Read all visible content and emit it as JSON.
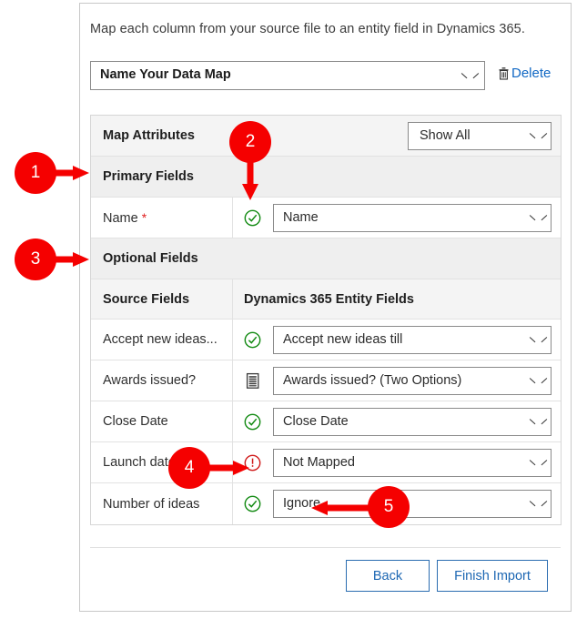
{
  "panel": {
    "intro": "Map each column from your source file to an entity field in Dynamics 365.",
    "data_map": {
      "selected": "Name Your Data Map",
      "delete_label": "Delete",
      "trash_icon": "trash-icon",
      "chevron_icon": "chevron-down-icon"
    }
  },
  "table": {
    "map_attributes": {
      "label": "Map Attributes",
      "filter_selected": "Show All"
    },
    "sections": [
      {
        "label": "Primary Fields"
      },
      {
        "label": "Optional Fields"
      }
    ],
    "column_headers": {
      "source": "Source Fields",
      "target": "Dynamics 365 Entity Fields"
    },
    "primary_rows": [
      {
        "source": "Name",
        "required": true,
        "required_marker": "*",
        "status_icon": "green-check-icon",
        "target": "Name"
      }
    ],
    "optional_rows": [
      {
        "source": "Accept new ideas...",
        "status_icon": "green-check-icon",
        "target": "Accept new ideas till"
      },
      {
        "source": "Awards issued?",
        "status_icon": "list-options-icon",
        "target": "Awards issued? (Two Options)"
      },
      {
        "source": "Close Date",
        "status_icon": "green-check-icon",
        "target": "Close Date"
      },
      {
        "source": "Launch date",
        "status_icon": "red-warning-icon",
        "target": "Not Mapped"
      },
      {
        "source": "Number of ideas",
        "status_icon": "green-check-icon",
        "target": "Ignore"
      }
    ]
  },
  "footer": {
    "back_label": "Back",
    "finish_label": "Finish Import"
  },
  "annotations": [
    {
      "number": "1",
      "direction": "right"
    },
    {
      "number": "2",
      "direction": "down"
    },
    {
      "number": "3",
      "direction": "right"
    },
    {
      "number": "4",
      "direction": "right"
    },
    {
      "number": "5",
      "direction": "left"
    }
  ],
  "colors": {
    "badge_red": "#f50000",
    "link_blue": "#1168c4",
    "button_blue": "#1d67b3",
    "status_green": "#128a12",
    "status_red": "#d01a1a",
    "required_star": "#e02020"
  }
}
